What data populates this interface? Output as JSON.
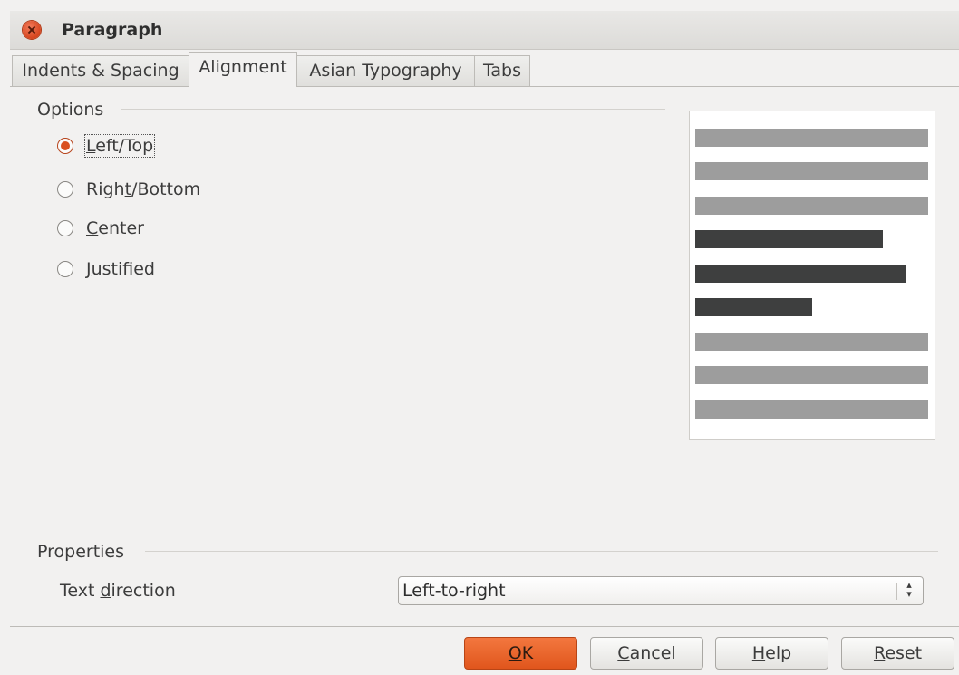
{
  "dialog": {
    "title": "Paragraph"
  },
  "tabs": [
    {
      "label": "Indents & Spacing",
      "active": false
    },
    {
      "label": "Alignment",
      "active": true
    },
    {
      "label": "Asian Typography",
      "active": false
    },
    {
      "label": "Tabs",
      "active": false
    }
  ],
  "options": {
    "section_label": "Options",
    "radios": [
      {
        "pre": "",
        "mnemonic": "L",
        "post": "eft/Top",
        "checked": true
      },
      {
        "pre": "Righ",
        "mnemonic": "t",
        "post": "/Bottom",
        "checked": false
      },
      {
        "pre": "",
        "mnemonic": "C",
        "post": "enter",
        "checked": false
      },
      {
        "pre": "",
        "mnemonic": "J",
        "post": "ustified",
        "checked": false
      }
    ]
  },
  "preview": {
    "description_lines": [
      "gray",
      "gray",
      "gray",
      "dark",
      "dark",
      "dark",
      "gray",
      "gray",
      "gray"
    ]
  },
  "properties": {
    "section_label": "Properties",
    "text_direction_label_pre": "Text ",
    "text_direction_label_mnemonic": "d",
    "text_direction_label_post": "irection",
    "text_direction_value": "Left-to-right"
  },
  "buttons": {
    "ok": {
      "mnemonic": "O",
      "post": "K"
    },
    "cancel": {
      "mnemonic": "C",
      "post": "ancel"
    },
    "help": {
      "mnemonic": "H",
      "post": "elp"
    },
    "reset": {
      "mnemonic": "R",
      "post": "eset"
    }
  },
  "colors": {
    "accent": "#e0561d",
    "preview_gray": "#9d9d9d",
    "preview_dark": "#3e3f3f"
  }
}
